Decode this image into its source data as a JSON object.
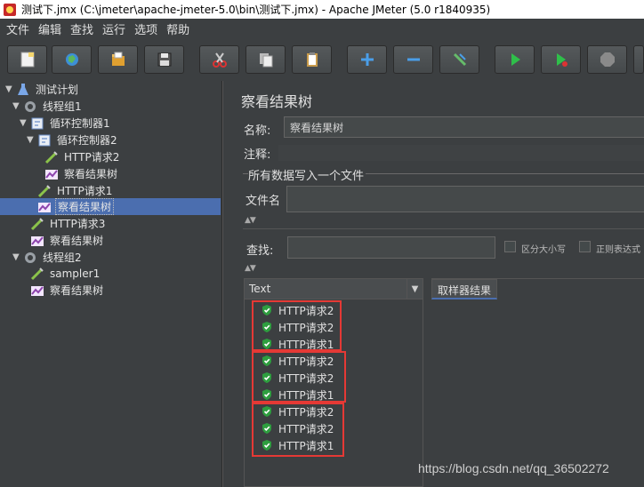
{
  "window": {
    "title": "测试下.jmx (C:\\jmeter\\apache-jmeter-5.0\\bin\\测试下.jmx) - Apache JMeter (5.0 r1840935)"
  },
  "menu": [
    "文件",
    "编辑",
    "查找",
    "运行",
    "选项",
    "帮助"
  ],
  "toolbar": [
    {
      "icon": "new-icon"
    },
    {
      "icon": "templates-icon"
    },
    {
      "icon": "open-icon"
    },
    {
      "icon": "save-icon"
    },
    {
      "icon": "cut-icon"
    },
    {
      "icon": "copy-icon"
    },
    {
      "icon": "paste-icon"
    },
    {
      "icon": "expand-icon"
    },
    {
      "icon": "collapse-icon"
    },
    {
      "icon": "toggle-icon"
    },
    {
      "icon": "start-icon"
    },
    {
      "icon": "start-no-pause-icon"
    },
    {
      "icon": "stop-icon"
    }
  ],
  "tree": [
    {
      "label": "测试计划",
      "icon": "test-plan-icon",
      "caret": "▼"
    },
    {
      "label": "线程组1",
      "icon": "thread-group-icon",
      "caret": "▼"
    },
    {
      "label": "循环控制器1",
      "icon": "loop-controller-icon",
      "caret": "▼"
    },
    {
      "label": "循环控制器2",
      "icon": "loop-controller-icon",
      "caret": "▼"
    },
    {
      "label": "HTTP请求2",
      "icon": "sampler-icon",
      "caret": ""
    },
    {
      "label": "察看结果树",
      "icon": "listener-icon",
      "caret": ""
    },
    {
      "label": "HTTP请求1",
      "icon": "sampler-icon",
      "caret": ""
    },
    {
      "label": "察看结果树",
      "icon": "listener-icon",
      "caret": "",
      "selected": true
    },
    {
      "label": "HTTP请求3",
      "icon": "sampler-icon",
      "caret": ""
    },
    {
      "label": "察看结果树",
      "icon": "listener-icon",
      "caret": ""
    },
    {
      "label": "线程组2",
      "icon": "thread-group-icon",
      "caret": "▼"
    },
    {
      "label": "sampler1",
      "icon": "sampler-icon",
      "caret": ""
    },
    {
      "label": "察看结果树",
      "icon": "listener-icon",
      "caret": ""
    }
  ],
  "panel": {
    "title": "察看结果树",
    "name_label": "名称:",
    "name_value": "察看结果树",
    "comment_label": "注释:",
    "file_group": "所有数据写入一个文件",
    "file_label": "文件名",
    "search_label": "查找:",
    "case_sensitive": "区分大小写",
    "regex": "正则表达式",
    "renderer": "Text",
    "results_tab": "取样器结果"
  },
  "results": [
    "HTTP请求2",
    "HTTP请求2",
    "HTTP请求1",
    "HTTP请求2",
    "HTTP请求2",
    "HTTP请求1",
    "HTTP请求2",
    "HTTP请求2",
    "HTTP请求1"
  ],
  "watermark": "https://blog.csdn.net/qq_36502272"
}
